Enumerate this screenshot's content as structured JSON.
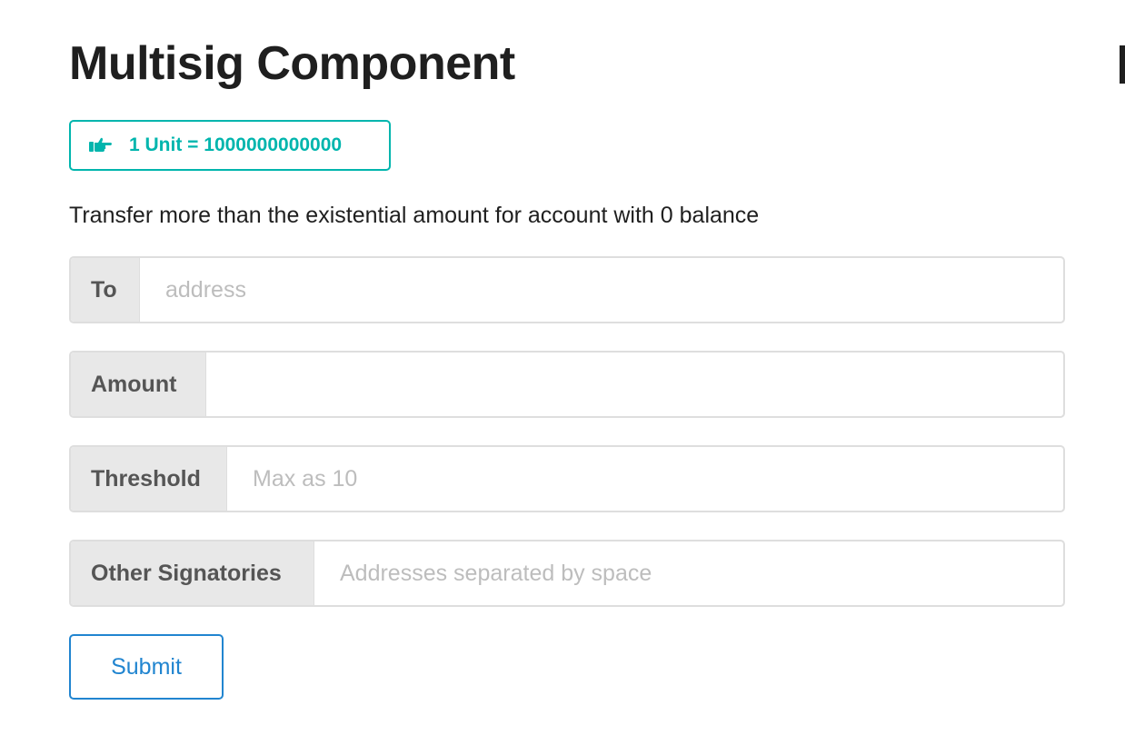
{
  "page": {
    "title": "Multisig Component"
  },
  "unit_badge": {
    "icon": "pointing-hand-icon",
    "text": "1 Unit = 1000000000000",
    "color": "#00b5ad"
  },
  "note": "Transfer more than the existential amount for account with 0 balance",
  "form": {
    "to": {
      "label": "To",
      "value": "",
      "placeholder": "address"
    },
    "amount": {
      "label": "Amount",
      "value": "",
      "placeholder": ""
    },
    "threshold": {
      "label": "Threshold",
      "value": "",
      "placeholder": "Max as 10"
    },
    "other_signatories": {
      "label": "Other Signatories",
      "value": "",
      "placeholder": "Addresses separated by space"
    },
    "submit_label": "Submit",
    "submit_color": "#2185d0"
  }
}
